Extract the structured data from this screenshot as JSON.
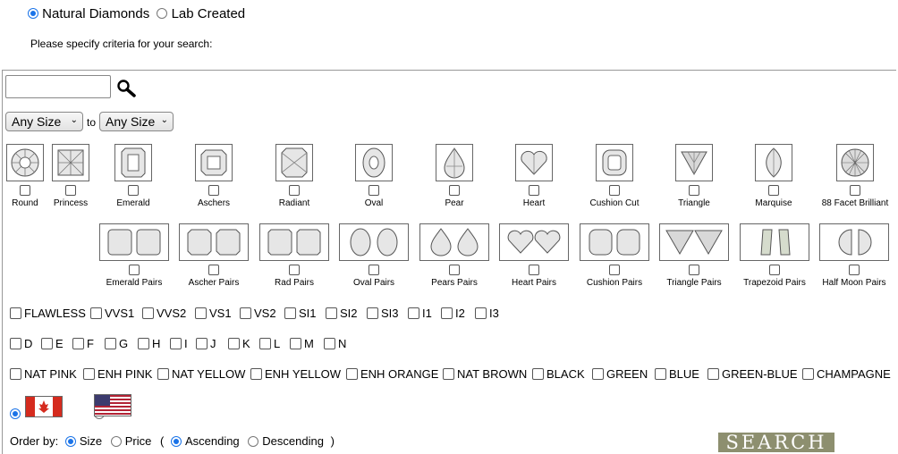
{
  "source_toggle": {
    "natural_label": "Natural Diamonds",
    "lab_label": "Lab Created",
    "selected": "natural"
  },
  "instructions": "Please specify criteria for your search:",
  "search": {
    "value": "",
    "placeholder": ""
  },
  "size": {
    "from": "Any Size",
    "to_label": "to",
    "to": "Any Size"
  },
  "shapes_row1": [
    "Round",
    "Princess",
    "Emerald",
    "Aschers",
    "Radiant",
    "Oval",
    "Pear",
    "Heart",
    "Cushion Cut",
    "Triangle",
    "Marquise",
    "88 Facet Brilliant"
  ],
  "shapes_row2": [
    "Emerald Pairs",
    "Ascher Pairs",
    "Rad Pairs",
    "Oval Pairs",
    "Pears Pairs",
    "Heart Pairs",
    "Cushion Pairs",
    "Triangle Pairs",
    "Trapezoid Pairs",
    "Half Moon Pairs"
  ],
  "clarity": [
    "FLAWLESS",
    "VVS1",
    "VVS2",
    "VS1",
    "VS2",
    "SI1",
    "SI2",
    "SI3",
    "I1",
    "I2",
    "I3"
  ],
  "color": [
    "D",
    "E",
    "F",
    "G",
    "H",
    "I",
    "J",
    "K",
    "L",
    "M",
    "N"
  ],
  "fancy_colors": [
    "NAT PINK",
    "ENH PINK",
    "NAT YELLOW",
    "ENH YELLOW",
    "ENH ORANGE",
    "NAT BROWN",
    "BLACK",
    "GREEN",
    "BLUE",
    "GREEN-BLUE",
    "CHAMPAGNE"
  ],
  "currency": {
    "selected": "canada",
    "flags": [
      "canada-flag-icon",
      "usa-flag-icon"
    ]
  },
  "order": {
    "label": "Order by:",
    "size_label": "Size",
    "price_label": "Price",
    "open_paren": "(",
    "asc_label": "Ascending",
    "desc_label": "Descending",
    "close_paren": ")",
    "selected_by": "size",
    "selected_dir": "ascending"
  },
  "search_button": "SEARCH",
  "colors": {
    "accent": "#1a73e8",
    "search_button_bg": "#8d8f6f"
  }
}
